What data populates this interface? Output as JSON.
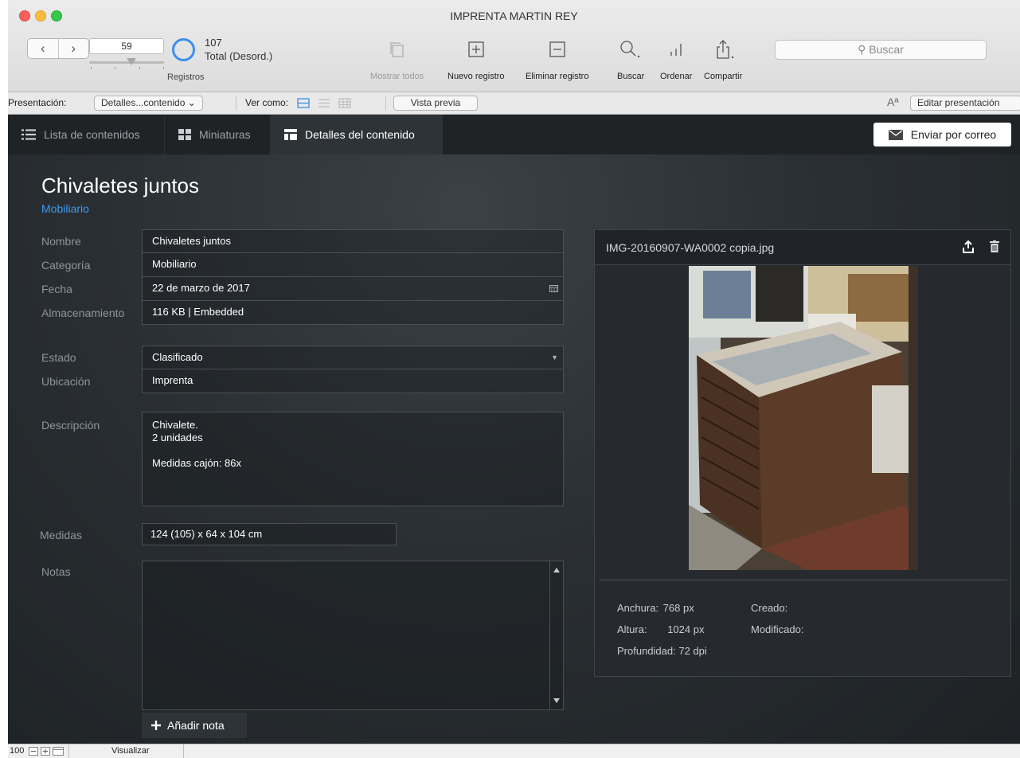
{
  "window": {
    "title": "IMPRENTA MARTIN REY"
  },
  "toolbar": {
    "record_number": "59",
    "total_count": "107",
    "total_label": "Total (Desord.)",
    "records_label": "Registros",
    "show_all": "Mostrar todos",
    "new_record": "Nuevo registro",
    "delete_record": "Eliminar registro",
    "find": "Buscar",
    "sort": "Ordenar",
    "share": "Compartir",
    "search_placeholder": "Buscar"
  },
  "layoutbar": {
    "layout_label": "Presentación:",
    "layout_value": "Detalles...contenido",
    "view_as_label": "Ver como:",
    "preview": "Vista previa",
    "font_icon_text": "Aª",
    "edit_layout": "Editar presentación"
  },
  "tabs": [
    {
      "label": "Lista de contenidos",
      "icon": "list-icon"
    },
    {
      "label": "Miniaturas",
      "icon": "thumbnails-icon"
    },
    {
      "label": "Detalles del contenido",
      "icon": "details-icon"
    }
  ],
  "email_button": "Enviar por correo",
  "record": {
    "title": "Chivaletes juntos",
    "category": "Mobiliario",
    "fields": {
      "nombre": {
        "label": "Nombre",
        "value": "Chivaletes juntos"
      },
      "categoria": {
        "label": "Categoría",
        "value": "Mobiliario"
      },
      "fecha": {
        "label": "Fecha",
        "value": "22 de marzo de 2017"
      },
      "almacenamiento": {
        "label": "Almacenamiento",
        "value": "116 KB | Embedded"
      },
      "estado": {
        "label": "Estado",
        "value": "Clasificado"
      },
      "ubicacion": {
        "label": "Ubicación",
        "value": "Imprenta"
      }
    },
    "descripcion": {
      "label": "Descripción",
      "lines": [
        "Chivalete.",
        "2 unidades",
        "",
        "Medidas cajón: 86x"
      ]
    },
    "medidas": {
      "label": "Medidas",
      "value": "124 (105) x 64 x 104 cm"
    },
    "notas": {
      "label": "Notas"
    },
    "add_note": "Añadir nota"
  },
  "image": {
    "filename": "IMG-20160907-WA0002 copia.jpg",
    "anchura_label": "Anchura:",
    "anchura_value": "768 px",
    "altura_label": "Altura:",
    "altura_value": "1024 px",
    "profundidad_label": "Profundidad:",
    "profundidad_value": "72 dpi",
    "creado_label": "Creado:",
    "modificado_label": "Modificado:"
  },
  "statusbar": {
    "zoom": "100",
    "mode": "Visualizar"
  },
  "colors": {
    "accent_blue": "#3d9bf0",
    "dark_bg": "#2a2f33",
    "tab_bg": "#202326"
  }
}
